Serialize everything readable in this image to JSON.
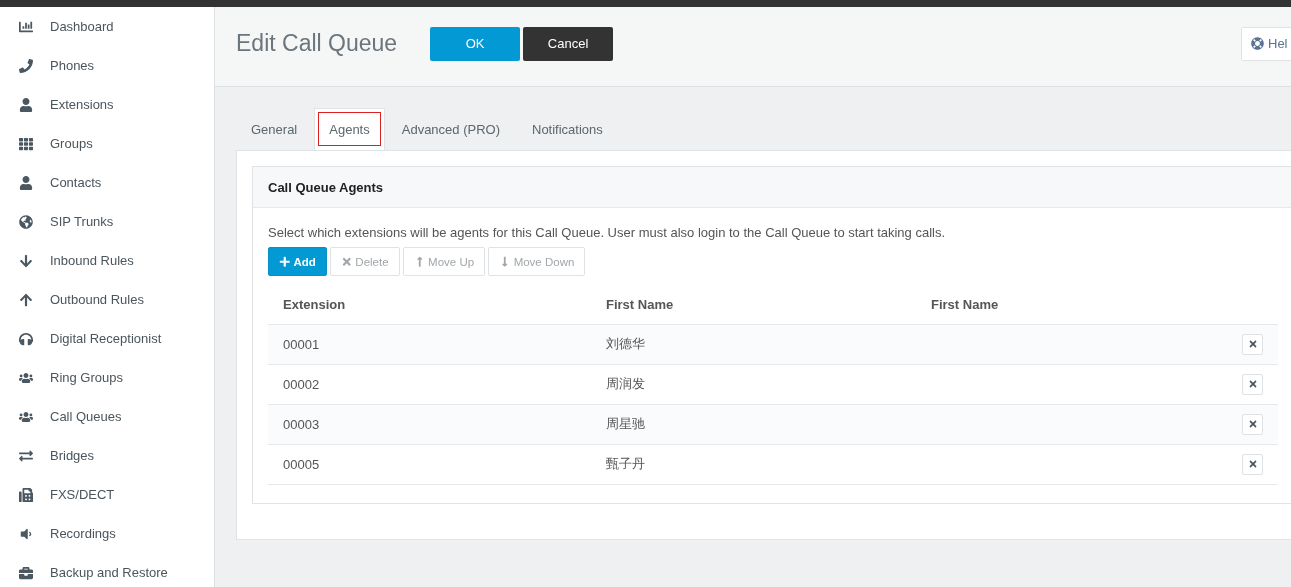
{
  "sidebar": {
    "items": [
      {
        "label": "Dashboard",
        "selected": false
      },
      {
        "label": "Phones",
        "selected": false
      },
      {
        "label": "Extensions",
        "selected": false
      },
      {
        "label": "Groups",
        "selected": false
      },
      {
        "label": "Contacts",
        "selected": false
      },
      {
        "label": "SIP Trunks",
        "selected": false
      },
      {
        "label": "Inbound Rules",
        "selected": false
      },
      {
        "label": "Outbound Rules",
        "selected": false
      },
      {
        "label": "Digital Receptionist",
        "selected": false
      },
      {
        "label": "Ring Groups",
        "selected": false
      },
      {
        "label": "Call Queues",
        "selected": false
      },
      {
        "label": "Bridges",
        "selected": false
      },
      {
        "label": "FXS/DECT",
        "selected": false
      },
      {
        "label": "Recordings",
        "selected": false
      },
      {
        "label": "Backup and Restore",
        "selected": false
      }
    ]
  },
  "header": {
    "title": "Edit Call Queue",
    "ok": "OK",
    "cancel": "Cancel",
    "help": "Hel"
  },
  "tabs": [
    {
      "label": "General",
      "selected": false
    },
    {
      "label": "Agents",
      "selected": true
    },
    {
      "label": "Advanced (PRO)",
      "selected": false
    },
    {
      "label": "Notifications",
      "selected": false
    }
  ],
  "card": {
    "title": "Call Queue Agents",
    "description": "Select which extensions will be agents for this Call Queue. User must also login to the Call Queue to start taking calls.",
    "toolbar": [
      {
        "label": "Add",
        "disabled": false
      },
      {
        "label": "Delete",
        "disabled": true
      },
      {
        "label": "Move Up",
        "disabled": true
      },
      {
        "label": "Move Down",
        "disabled": true
      }
    ],
    "table": {
      "columns": [
        "Extension",
        "First Name",
        "First Name"
      ],
      "rows": [
        {
          "cells": [
            "00001",
            "刘德华",
            ""
          ]
        },
        {
          "cells": [
            "00002",
            "周润发",
            ""
          ]
        },
        {
          "cells": [
            "00003",
            "周星驰",
            ""
          ]
        },
        {
          "cells": [
            "00005",
            "甄子丹",
            ""
          ]
        }
      ]
    }
  }
}
